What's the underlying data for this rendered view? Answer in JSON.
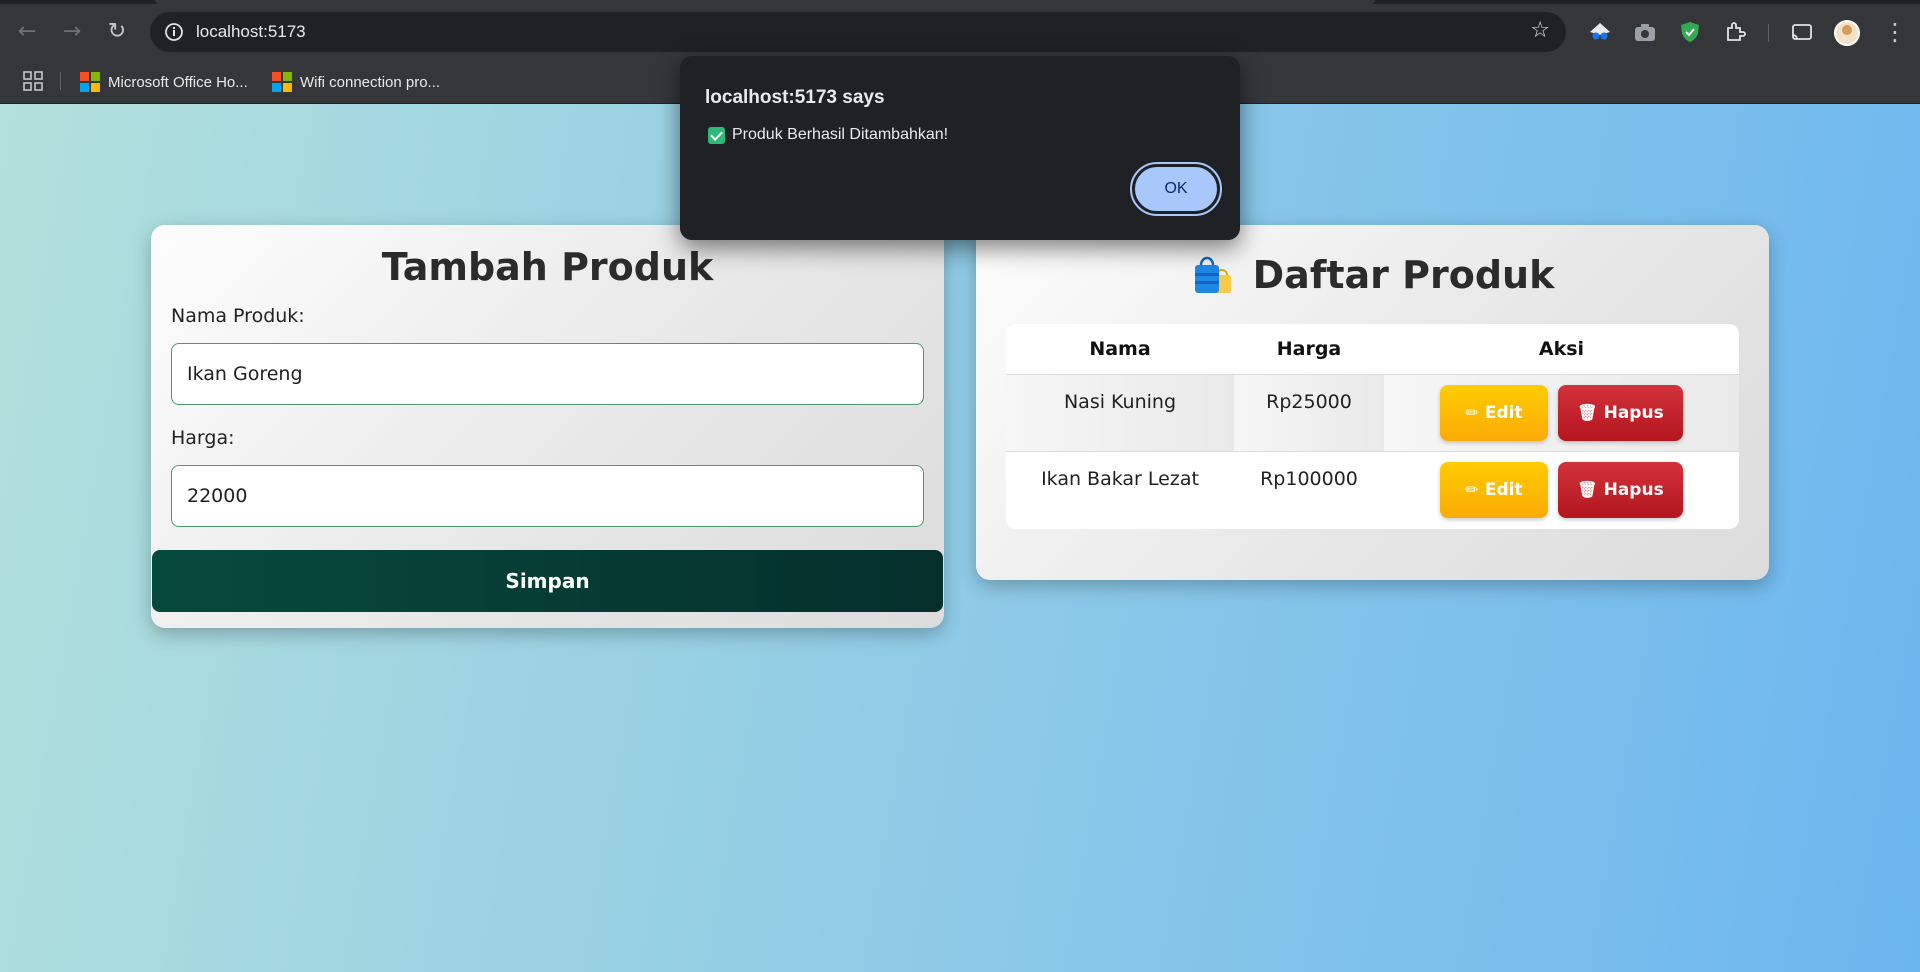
{
  "browser": {
    "url": "localhost:5173",
    "bookmarks": [
      {
        "label": "Microsoft Office Ho..."
      },
      {
        "label": "Wifi connection pro..."
      }
    ]
  },
  "form": {
    "title": "Tambah Produk",
    "name_label": "Nama Produk:",
    "name_value": "Ikan Goreng",
    "price_label": "Harga:",
    "price_value": "22000",
    "save_label": "Simpan"
  },
  "list": {
    "title": "Daftar Produk",
    "columns": [
      "Nama",
      "Harga",
      "Aksi"
    ],
    "rows": [
      {
        "nama": "Nasi Kuning",
        "harga": "Rp25000"
      },
      {
        "nama": "Ikan Bakar Lezat",
        "harga": "Rp100000"
      }
    ],
    "edit_label": "Edit",
    "delete_label": "Hapus"
  },
  "dialog": {
    "title": "localhost:5173 says",
    "message": "Produk Berhasil Ditambahkan!",
    "ok_label": "OK"
  }
}
